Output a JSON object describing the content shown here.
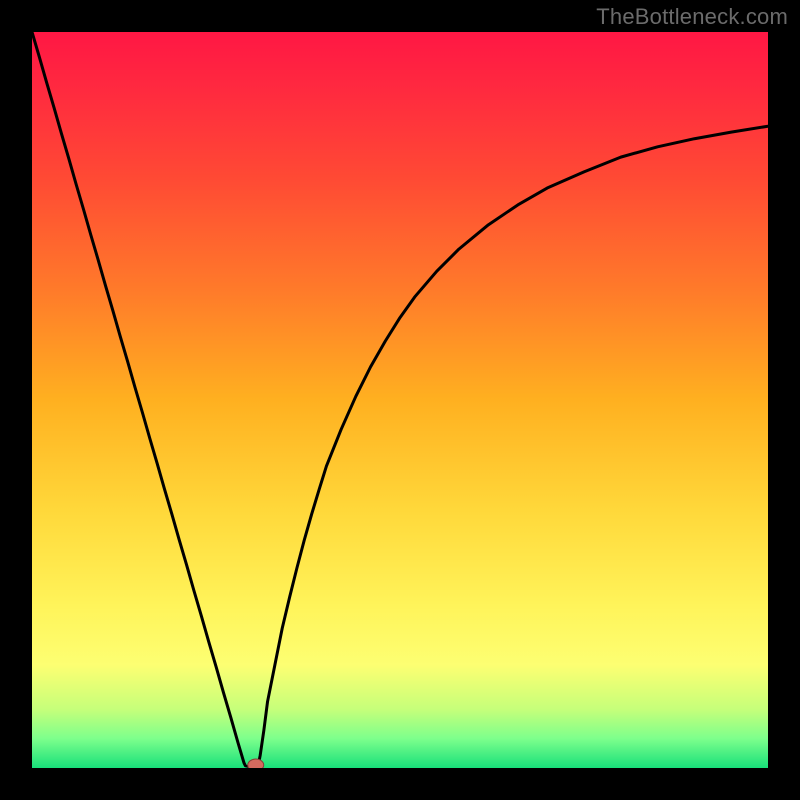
{
  "watermark": "TheBottleneck.com",
  "colors": {
    "frame": "#000000",
    "curve_stroke": "#000000",
    "marker_fill": "#d46a5f",
    "marker_stroke": "#8a3e38",
    "gradient_stops": [
      {
        "offset": 0.0,
        "color": "#ff1744"
      },
      {
        "offset": 0.08,
        "color": "#ff2a3f"
      },
      {
        "offset": 0.2,
        "color": "#ff4a34"
      },
      {
        "offset": 0.35,
        "color": "#ff7a2a"
      },
      {
        "offset": 0.5,
        "color": "#ffb020"
      },
      {
        "offset": 0.65,
        "color": "#ffd83a"
      },
      {
        "offset": 0.78,
        "color": "#fff45a"
      },
      {
        "offset": 0.86,
        "color": "#fdff72"
      },
      {
        "offset": 0.92,
        "color": "#c6ff7a"
      },
      {
        "offset": 0.96,
        "color": "#7dff8c"
      },
      {
        "offset": 1.0,
        "color": "#18e07a"
      }
    ]
  },
  "chart_data": {
    "type": "line",
    "title": "",
    "xlabel": "",
    "ylabel": "",
    "xlim": [
      0,
      100
    ],
    "ylim": [
      0,
      100
    ],
    "grid": false,
    "legend": false,
    "x": [
      0,
      1,
      2,
      3,
      4,
      5,
      6,
      7,
      8,
      9,
      10,
      11,
      12,
      13,
      14,
      15,
      16,
      17,
      18,
      19,
      20,
      21,
      22,
      23,
      24,
      25,
      26,
      27,
      28,
      28.8,
      29,
      29.5,
      30,
      30.4,
      30.8,
      31,
      31.5,
      32,
      33,
      34,
      35,
      36,
      37,
      38,
      39,
      40,
      42,
      44,
      46,
      48,
      50,
      52,
      55,
      58,
      62,
      66,
      70,
      75,
      80,
      85,
      90,
      95,
      100
    ],
    "values": [
      100,
      96.6,
      93.1,
      89.7,
      86.2,
      82.8,
      79.3,
      75.9,
      72.4,
      69.0,
      65.5,
      62.1,
      58.6,
      55.2,
      51.7,
      48.3,
      44.8,
      41.4,
      37.9,
      34.5,
      31.0,
      27.6,
      24.1,
      20.7,
      17.2,
      13.8,
      10.3,
      6.9,
      3.4,
      0.7,
      0.3,
      0.2,
      0.3,
      0.4,
      0.7,
      1.7,
      5.1,
      9.0,
      14.0,
      19.0,
      23.2,
      27.2,
      31.0,
      34.5,
      37.8,
      41.0,
      46.0,
      50.5,
      54.5,
      58.0,
      61.2,
      64.0,
      67.5,
      70.5,
      73.8,
      76.5,
      78.8,
      81.0,
      83.0,
      84.4,
      85.5,
      86.4,
      87.2
    ],
    "marker": {
      "x": 30.4,
      "y": 0.4
    }
  }
}
